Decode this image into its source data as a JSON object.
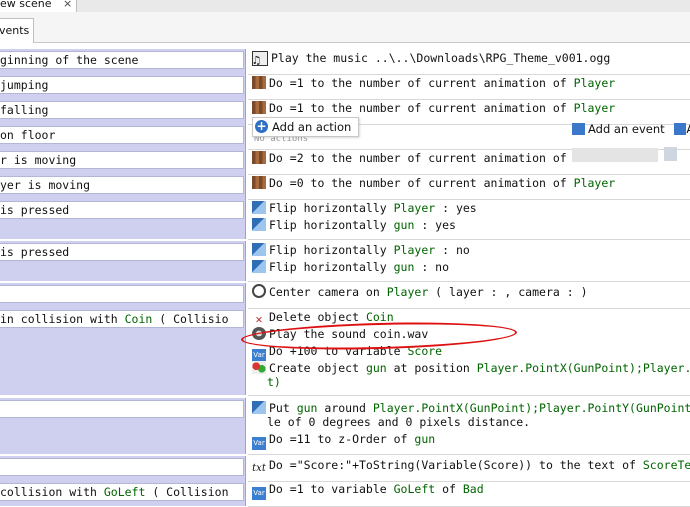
{
  "header": {
    "scene_tab_label": "ew scene",
    "close_glyph": "×",
    "events_tab_label": "vents"
  },
  "popup": {
    "add_action_label": "Add an action",
    "plus_glyph": "+",
    "faded_text": "No actions"
  },
  "toolbar": {
    "add_event_label": "Add an event",
    "next_glyph": "A"
  },
  "rows": [
    {
      "condition": "ginning of the scene",
      "actions": [
        {
          "icon": "music-icon",
          "parts": [
            {
              "t": "Play the music ..\\..\\Downloads\\RPG_Theme_v001.ogg"
            }
          ]
        }
      ]
    },
    {
      "condition": " jumping",
      "actions": [
        {
          "icon": "animation-icon",
          "parts": [
            {
              "t": "Do =1 to the number of current animation of "
            },
            {
              "t": "Player",
              "obj": true
            }
          ]
        }
      ]
    },
    {
      "condition": " falling",
      "actions": [
        {
          "icon": "animation-icon",
          "parts": [
            {
              "t": "Do =1 to the number of current animation of "
            },
            {
              "t": "Player",
              "obj": true
            }
          ]
        }
      ]
    },
    {
      "condition": " on floor",
      "actions": []
    },
    {
      "condition": "r is moving",
      "actions": [
        {
          "icon": "animation-icon",
          "parts": [
            {
              "t": "Do =2 to the number of current animation of"
            }
          ]
        }
      ]
    },
    {
      "condition": "yer is moving",
      "actions": [
        {
          "icon": "animation-icon",
          "parts": [
            {
              "t": "Do =0 to the number of current animation of "
            },
            {
              "t": "Player",
              "obj": true
            }
          ]
        }
      ]
    },
    {
      "condition": "is pressed",
      "actions": [
        {
          "icon": "flip-icon",
          "parts": [
            {
              "t": "Flip horizontally "
            },
            {
              "t": "Player",
              "obj": true
            },
            {
              "t": " : yes"
            }
          ]
        },
        {
          "icon": "flip-icon",
          "parts": [
            {
              "t": "Flip horizontally "
            },
            {
              "t": "gun",
              "obj": true
            },
            {
              "t": " : yes"
            }
          ]
        }
      ]
    },
    {
      "condition": " is pressed",
      "actions": [
        {
          "icon": "flip-icon",
          "parts": [
            {
              "t": "Flip horizontally "
            },
            {
              "t": "Player",
              "obj": true
            },
            {
              "t": " : no"
            }
          ]
        },
        {
          "icon": "flip-icon",
          "parts": [
            {
              "t": "Flip horizontally "
            },
            {
              "t": "gun",
              "obj": true
            },
            {
              "t": " : no"
            }
          ]
        }
      ]
    },
    {
      "condition": "",
      "actions": [
        {
          "icon": "camera-icon",
          "parts": [
            {
              "t": "Center camera on "
            },
            {
              "t": "Player",
              "obj": true
            },
            {
              "t": " ( layer : , camera :  )"
            }
          ]
        }
      ]
    },
    {
      "condition_parts": [
        {
          "t": " in collision with "
        },
        {
          "t": "Coin",
          "obj": true
        },
        {
          "t": " ( Collisio"
        }
      ],
      "actions": [
        {
          "icon": "delete-icon",
          "parts": [
            {
              "t": "Delete object "
            },
            {
              "t": "Coin",
              "obj": true
            }
          ]
        },
        {
          "icon": "sound-icon",
          "parts": [
            {
              "t": "Play the sound coin.wav"
            }
          ]
        },
        {
          "icon": "variable-icon",
          "parts": [
            {
              "t": "Do +100 to variable "
            },
            {
              "t": "Score",
              "obj": true
            }
          ]
        },
        {
          "icon": "create-object-icon",
          "parts": [
            {
              "t": "Create object "
            },
            {
              "t": "gun",
              "obj": true
            },
            {
              "t": " at position "
            },
            {
              "t": "Player.PointX(GunPoint);Player.",
              "obj": true
            }
          ]
        },
        {
          "icon": "",
          "parts": [
            {
              "t": "t)",
              "obj": true
            }
          ]
        }
      ]
    },
    {
      "condition": "",
      "actions": [
        {
          "icon": "flip-icon",
          "parts": [
            {
              "t": "Put "
            },
            {
              "t": "gun",
              "obj": true
            },
            {
              "t": " around "
            },
            {
              "t": "Player.PointX(GunPoint);Player.PointY(GunPoint",
              "obj": true
            }
          ]
        },
        {
          "icon": "",
          "parts": [
            {
              "t": "le of 0 degrees and 0 pixels distance."
            }
          ]
        },
        {
          "icon": "variable-icon",
          "parts": [
            {
              "t": "Do =11 to z-Order of "
            },
            {
              "t": "gun",
              "obj": true
            }
          ]
        }
      ]
    },
    {
      "condition": "",
      "actions": [
        {
          "icon": "text-icon",
          "parts": [
            {
              "t": "Do =\"Score:\"+ToString(Variable(Score)) to the text of "
            },
            {
              "t": "ScoreTe",
              "obj": true
            }
          ]
        }
      ]
    },
    {
      "condition_parts": [
        {
          "t": " collision with "
        },
        {
          "t": "GoLeft",
          "obj": true
        },
        {
          "t": " ( Collision"
        }
      ],
      "actions": [
        {
          "icon": "variable-icon",
          "parts": [
            {
              "t": "Do =1 to variable "
            },
            {
              "t": "GoLeft",
              "obj": true
            },
            {
              "t": " of "
            },
            {
              "t": "Bad",
              "obj": true
            }
          ]
        }
      ]
    }
  ],
  "icon_glyphs": {
    "music-icon": "♫",
    "delete-icon": "✕",
    "variable-icon": "Var",
    "text-icon": "txt"
  },
  "colors": {
    "condition_bg": "#cfd0ef",
    "object_name": "#006400",
    "annotation_circle": "#d11111"
  }
}
